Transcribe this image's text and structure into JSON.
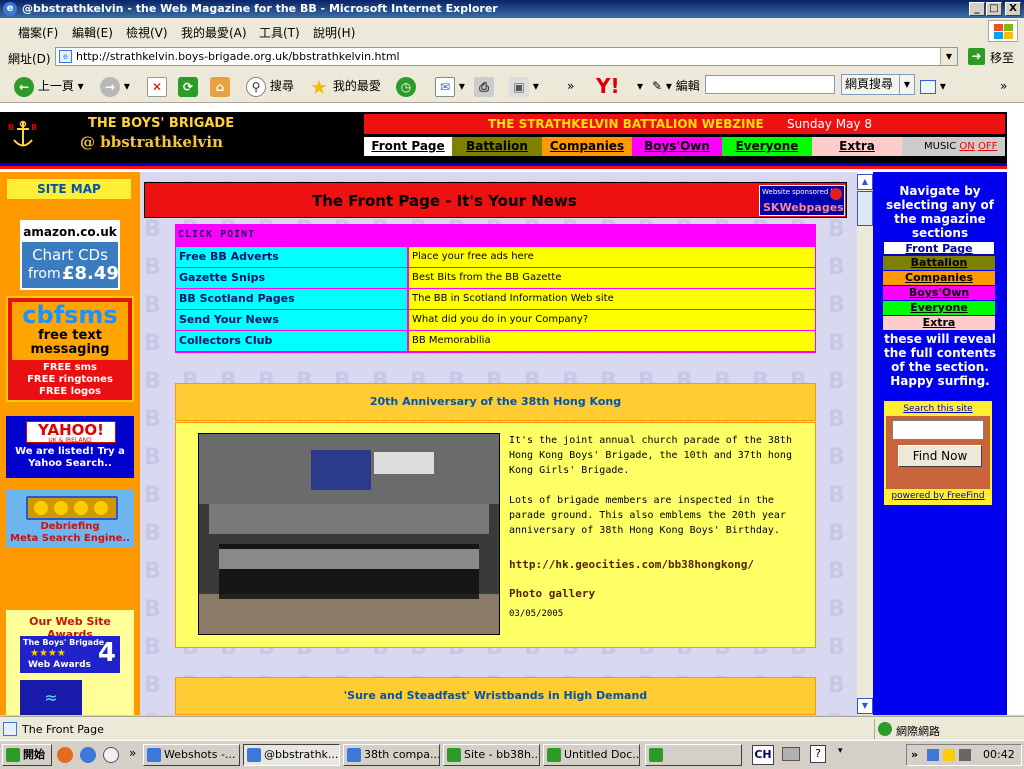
{
  "window": {
    "title": "@bbstrathkelvin - the Web Magazine for the BB - Microsoft Internet Explorer",
    "minimize": "_",
    "maximize": "□",
    "close": "X"
  },
  "menu": [
    "檔案(F)",
    "編輯(E)",
    "檢視(V)",
    "我的最愛(A)",
    "工具(T)",
    "說明(H)"
  ],
  "address": {
    "label": "網址(D)",
    "url": "http://strathkelvin.boys-brigade.org.uk/bbstrathkelvin.html",
    "go": "移至"
  },
  "toolbar": {
    "back": "上一頁",
    "search": "搜尋",
    "favorites": "我的最愛",
    "edit": "編輯",
    "web_search": "網頁搜尋",
    "more": "»"
  },
  "header": {
    "org": "THE BOYS' BRIGADE",
    "handle": "@ bbstrathkelvin",
    "webzine": "THE STRATHKELVIN BATTALION WEBZINE",
    "date": "Sunday May 8",
    "tabs": [
      {
        "label": "Front Page",
        "color": "#ffffff"
      },
      {
        "label": "Battalion",
        "color": "#808000"
      },
      {
        "label": "Companies",
        "color": "#ff9900"
      },
      {
        "label": "Boys'Own",
        "color": "#ff00ff"
      },
      {
        "label": "Everyone",
        "color": "#00ff00"
      },
      {
        "label": "Extra",
        "color": "#ffcccc"
      }
    ],
    "music_label": "MUSIC",
    "music_on": "ON",
    "music_off": "OFF"
  },
  "left": {
    "site_map": "SITE MAP",
    "amazon": {
      "brand": "amazon.co.uk",
      "line1": "Chart CDs",
      "line2_from": "from",
      "price": "£8.49"
    },
    "cbfsms": {
      "brand": "cbfsms",
      "line1": "free text",
      "line2": "messaging",
      "f1": "FREE sms",
      "f2": "FREE ringtones",
      "f3": "FREE logos"
    },
    "yahoo": {
      "brand": "YAHOO!",
      "sub": "UK & IRELAND",
      "text": "We are listed! Try a Yahoo Search.."
    },
    "debrief": {
      "text1": "Debriefing",
      "text2": "Meta Search Engine.."
    },
    "awards": {
      "title": "Our Web Site Awards",
      "badge1": "The Boys' Brigade",
      "badge2": "Web Awards",
      "stars": "★★★★",
      "number": "4"
    }
  },
  "centre": {
    "front_title": "The Front Page - It's Your News",
    "sponsor_line": "Website sponsored by",
    "sponsor_name": "SKWebpages",
    "click_point": "CLICK POINT",
    "click_rows": [
      {
        "link": "Free BB Adverts",
        "desc": "Place your free ads here"
      },
      {
        "link": "Gazette Snips",
        "desc": "Best Bits from the BB Gazette"
      },
      {
        "link": "BB Scotland Pages",
        "desc": "The BB in Scotland Information Web site"
      },
      {
        "link": "Send Your News",
        "desc": "What did you do in your Company?"
      },
      {
        "link": "Collectors Club",
        "desc": "BB Memorabilia"
      }
    ],
    "story1": {
      "title": "20th Anniversary of the 38th Hong Kong",
      "para1": "It's the joint annual church parade of the 38th Hong Kong Boys' Brigade, the 10th and 37th hong Kong Girls' Brigade.",
      "para2": "Lots of brigade members are inspected in the parade ground. This also emblems the 20th year anniversary of 38th Hong Kong Boys' Birthday.",
      "link": "http://hk.geocities.com/bb38hongkong/",
      "gallery": "Photo gallery",
      "date": "03/05/2005"
    },
    "story2": {
      "title": "'Sure and Steadfast' Wristbands in High Demand"
    }
  },
  "right": {
    "intro": "Navigate by selecting any of the magazine sections",
    "outro": "these will reveal the full contents of the section. Happy surfing.",
    "search_label": "Search this site",
    "find_now": "Find Now",
    "powered": "powered by FreeFind"
  },
  "status": {
    "text": "The Front Page",
    "zone": "網際網路"
  },
  "taskbar": {
    "start": "開始",
    "tasks": [
      "Webshots -...",
      "@bbstrathk...",
      "38th compa...",
      "Site - bb38h...",
      "Untitled Doc..."
    ],
    "lang": "CH",
    "clock": "00:42",
    "more": "»"
  }
}
